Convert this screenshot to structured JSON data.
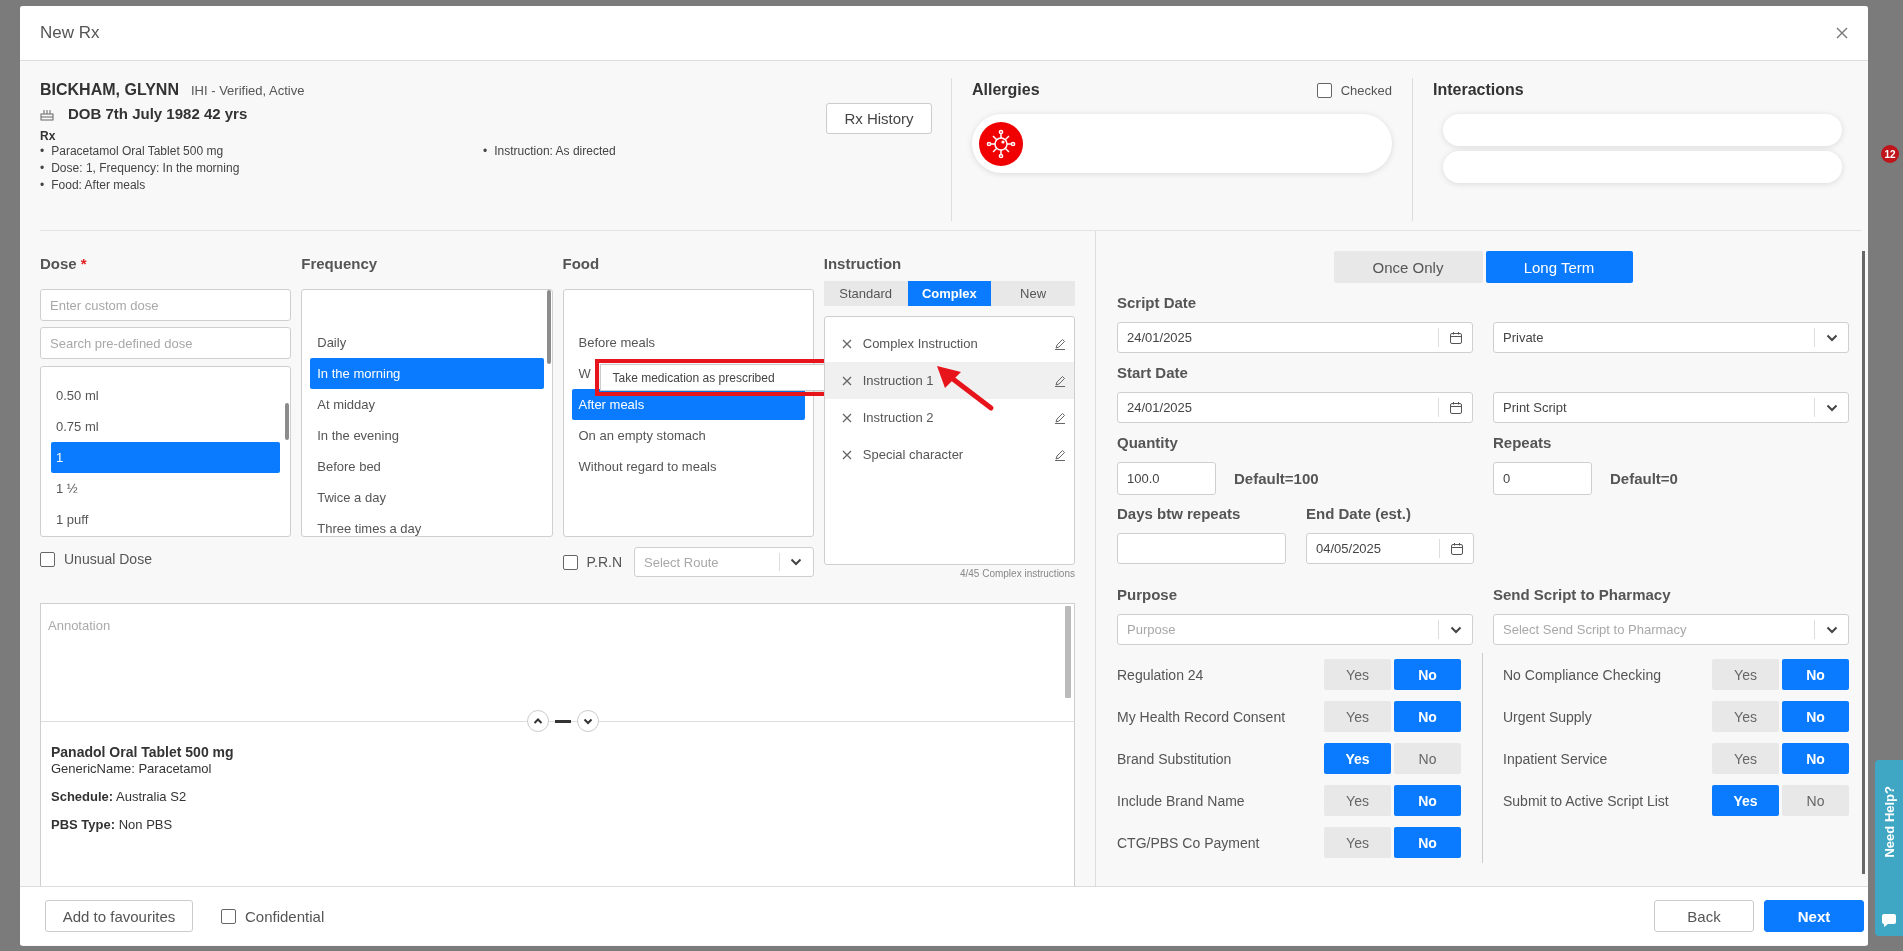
{
  "window": {
    "title": "New Rx"
  },
  "patient": {
    "name": "BICKHAM, GLYNN",
    "ihi": "IHI - Verified, Active",
    "dob": "DOB 7th July 1982 42 yrs",
    "rx_heading": "Rx",
    "bullet": "•",
    "rx_items": [
      "Paracetamol Oral Tablet 500 mg",
      "Dose: 1, Frequency: In the morning",
      "Food: After meals"
    ],
    "rx_items_2": [
      "Instruction: As directed"
    ],
    "history_button": "Rx History"
  },
  "allergies": {
    "title": "Allergies",
    "checked_label": "Checked",
    "checked": false
  },
  "interactions": {
    "title": "Interactions"
  },
  "dose": {
    "label": "Dose",
    "required_mark": "*",
    "custom_placeholder": "Enter custom dose",
    "search_placeholder": "Search pre-defined dose",
    "options": [
      {
        "label": "0.50 ml",
        "selected": false
      },
      {
        "label": "0.75 ml",
        "selected": false
      },
      {
        "label": "1",
        "selected": true
      },
      {
        "label": "1 ½",
        "selected": false
      },
      {
        "label": "1 puff",
        "selected": false
      }
    ],
    "unusual": {
      "label": "Unusual Dose",
      "checked": false
    }
  },
  "frequency": {
    "label": "Frequency",
    "options": [
      {
        "label": "Daily",
        "selected": false
      },
      {
        "label": "In the morning",
        "selected": true
      },
      {
        "label": "At midday",
        "selected": false
      },
      {
        "label": "In the evening",
        "selected": false
      },
      {
        "label": "Before bed",
        "selected": false
      },
      {
        "label": "Twice a day",
        "selected": false
      },
      {
        "label": "Three times a day",
        "selected": false
      }
    ]
  },
  "food": {
    "label": "Food",
    "options": [
      {
        "label": "Before meals",
        "selected": false
      },
      {
        "label": "W",
        "selected": false
      },
      {
        "label": "After meals",
        "selected": true
      },
      {
        "label": "On an empty stomach",
        "selected": false
      },
      {
        "label": "Without regard to meals",
        "selected": false
      }
    ],
    "prn": {
      "label": "P.R.N",
      "checked": false
    },
    "route_placeholder": "Select Route"
  },
  "tooltip": {
    "text": "Take medication as prescribed"
  },
  "instruction": {
    "label": "Instruction",
    "tabs": [
      {
        "label": "Standard",
        "selected": false
      },
      {
        "label": "Complex",
        "selected": true
      },
      {
        "label": "New",
        "selected": false
      }
    ],
    "items": [
      {
        "label": "Complex Instruction",
        "selected": false
      },
      {
        "label": "Instruction 1",
        "selected": true
      },
      {
        "label": "Instruction 2",
        "selected": false
      },
      {
        "label": "Special character",
        "selected": false
      }
    ],
    "count": "4/45 Complex instructions"
  },
  "annotation": {
    "placeholder": "Annotation"
  },
  "drug_info": {
    "title": "Panadol Oral Tablet 500 mg",
    "lines": [
      "GenericName: Paracetamol",
      "**Schedule:** Australia S2",
      "**PBS Type:** Non PBS"
    ]
  },
  "script": {
    "term_options": [
      {
        "label": "Once Only",
        "selected": false
      },
      {
        "label": "Long Term",
        "selected": true
      }
    ],
    "script_date": {
      "label": "Script Date",
      "value": "24/01/2025"
    },
    "script_type": {
      "value": "Private"
    },
    "start_date": {
      "label": "Start Date",
      "value": "24/01/2025"
    },
    "delivery": {
      "value": "Print Script"
    },
    "quantity": {
      "label": "Quantity",
      "value": "100.0",
      "default": "Default=100"
    },
    "repeats": {
      "label": "Repeats",
      "value": "0",
      "default": "Default=0"
    },
    "days_between_repeats": {
      "label": "Days btw repeats"
    },
    "end_date": {
      "label": "End Date (est.)",
      "value": "04/05/2025"
    },
    "purpose": {
      "label": "Purpose",
      "placeholder": "Purpose"
    },
    "send_to_pharmacy": {
      "label": "Send Script to Pharmacy",
      "placeholder": "Select Send Script to Pharmacy"
    },
    "options_left": [
      {
        "label": "Regulation 24",
        "yes_label": "Yes",
        "no_label": "No",
        "yes": false
      },
      {
        "label": "My Health Record Consent",
        "yes_label": "Yes",
        "no_label": "No",
        "yes": false
      },
      {
        "label": "Brand Substitution",
        "yes_label": "Yes",
        "no_label": "No",
        "yes": true
      },
      {
        "label": "Include Brand Name",
        "yes_label": "Yes",
        "no_label": "No",
        "yes": false
      },
      {
        "label": "CTG/PBS Co Payment",
        "yes_label": "Yes",
        "no_label": "No",
        "yes": false
      }
    ],
    "options_right": [
      {
        "label": "No Compliance Checking",
        "yes_label": "Yes",
        "no_label": "No",
        "yes": false
      },
      {
        "label": "Urgent Supply",
        "yes_label": "Yes",
        "no_label": "No",
        "yes": false
      },
      {
        "label": "Inpatient Service",
        "yes_label": "Yes",
        "no_label": "No",
        "yes": false
      },
      {
        "label": "Submit to Active Script List",
        "yes_label": "Yes",
        "no_label": "No",
        "yes": true
      }
    ]
  },
  "footer": {
    "favourites_button": "Add to favourites",
    "confidential": {
      "label": "Confidential",
      "checked": false
    },
    "back_button": "Back",
    "next_button": "Next"
  },
  "notification_badge": {
    "count": "12"
  },
  "help_tab": {
    "label": "Need Help?"
  }
}
